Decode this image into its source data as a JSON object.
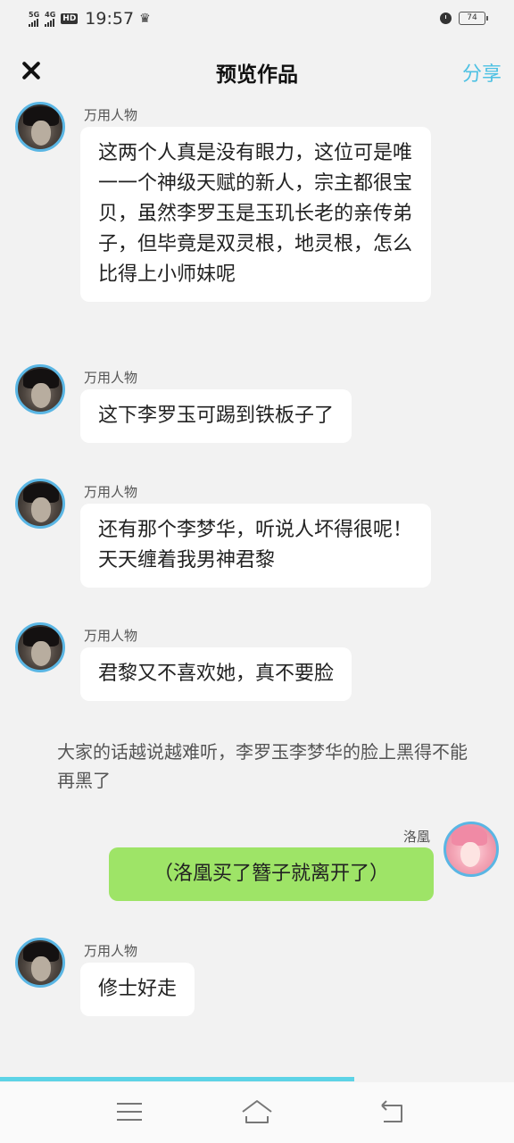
{
  "status": {
    "net1": "5G",
    "net2": "4G",
    "hd": "HD",
    "time": "19:57",
    "battery": "74"
  },
  "header": {
    "title": "预览作品",
    "share": "分享"
  },
  "messages": [
    {
      "sender": "万用人物",
      "text": "这两个人真是没有眼力，这位可是唯一一个神级天赋的新人，宗主都很宝贝，虽然李罗玉是玉玑长老的亲传弟子，但毕竟是双灵根，地灵根，怎么比得上小师妹呢"
    },
    {
      "sender": "万用人物",
      "text": "这下李罗玉可踢到铁板子了"
    },
    {
      "sender": "万用人物",
      "text": "还有那个李梦华，听说人坏得很呢！天天缠着我男神君黎"
    },
    {
      "sender": "万用人物",
      "text": "君黎又不喜欢她，真不要脸"
    },
    {
      "sender": "洛凰",
      "text": "（洛凰买了簪子就离开了）"
    },
    {
      "sender": "万用人物",
      "text": "修士好走"
    }
  ],
  "narration": "大家的话越说越难听，李罗玉李梦华的脸上黑得不能再黑了",
  "progress": {
    "fraction": 0.69,
    "color": "#5dd3e6"
  },
  "colors": {
    "accent": "#4ec1e3",
    "bubble_self": "#9ee467",
    "avatar_ring": "#5ab6e4"
  },
  "nav": {
    "icons": [
      "menu-icon",
      "home-icon",
      "back-icon"
    ]
  }
}
